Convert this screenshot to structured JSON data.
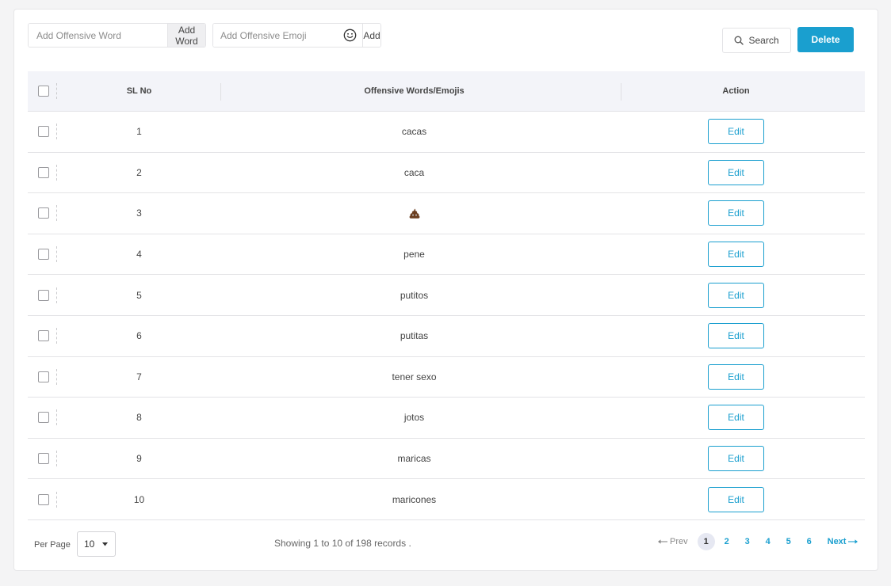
{
  "toolbar": {
    "word_placeholder": "Add Offensive Word",
    "add_word_label": "Add Word",
    "emoji_placeholder": "Add Offensive Emoji",
    "add_label": "Add",
    "search_label": "Search",
    "delete_label": "Delete"
  },
  "table": {
    "headers": {
      "sl_no": "SL No",
      "words": "Offensive Words/Emojis",
      "action": "Action"
    },
    "rows": [
      {
        "sl": "1",
        "word": "cacas"
      },
      {
        "sl": "2",
        "word": "caca"
      },
      {
        "sl": "3",
        "word": "",
        "emoji": "pile-of-poo-icon"
      },
      {
        "sl": "4",
        "word": "pene"
      },
      {
        "sl": "5",
        "word": "putitos"
      },
      {
        "sl": "6",
        "word": "putitas"
      },
      {
        "sl": "7",
        "word": "tener sexo"
      },
      {
        "sl": "8",
        "word": "jotos"
      },
      {
        "sl": "9",
        "word": "maricas"
      },
      {
        "sl": "10",
        "word": "maricones"
      }
    ],
    "edit_label": "Edit"
  },
  "footer": {
    "per_page_label": "Per Page",
    "per_page_value": "10",
    "records_text": "Showing 1 to 10 of 198 records .",
    "prev_label": "Prev",
    "next_label": "Next",
    "pages": [
      "1",
      "2",
      "3",
      "4",
      "5",
      "6"
    ],
    "current_page": "1"
  },
  "colors": {
    "accent": "#1a9fcf",
    "header_bg": "#f3f4f9",
    "page_bg": "#f4f4f5"
  }
}
